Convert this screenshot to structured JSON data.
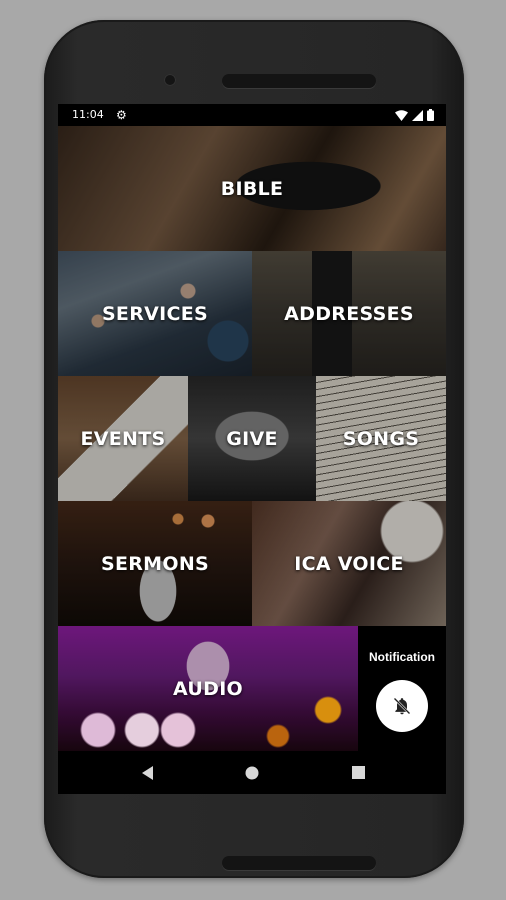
{
  "status_bar": {
    "time": "11:04",
    "icons": [
      "settings-icon",
      "wifi-icon",
      "signal-icon",
      "battery-icon"
    ]
  },
  "tiles": [
    {
      "label": "BIBLE"
    },
    {
      "label": "SERVICES"
    },
    {
      "label": "ADDRESSES"
    },
    {
      "label": "EVENTS"
    },
    {
      "label": "GIVE"
    },
    {
      "label": "SONGS"
    },
    {
      "label": "SERMONS"
    },
    {
      "label": "ICA VOICE"
    },
    {
      "label": "AUDIO"
    }
  ],
  "notification": {
    "title": "Notification",
    "icon": "bell-off-icon"
  },
  "nav_bar": {
    "icons": [
      "back-icon",
      "home-icon",
      "recents-icon"
    ]
  },
  "colors": {
    "device_body": "#262626",
    "page_background": "#a8a8a8",
    "label_text": "#ffffff",
    "notification_button": "#ffffff"
  }
}
